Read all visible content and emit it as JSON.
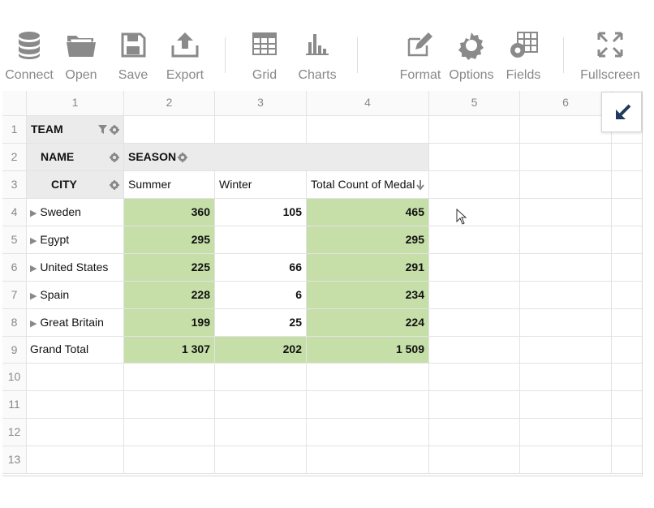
{
  "toolbar": {
    "connect": "Connect",
    "open": "Open",
    "save": "Save",
    "export": "Export",
    "grid": "Grid",
    "charts": "Charts",
    "format": "Format",
    "options": "Options",
    "fields": "Fields",
    "fullscreen": "Fullscreen"
  },
  "columns": [
    "1",
    "2",
    "3",
    "4",
    "5",
    "6"
  ],
  "rows": [
    "1",
    "2",
    "3",
    "4",
    "5",
    "6",
    "7",
    "8",
    "9",
    "10",
    "11",
    "12",
    "13"
  ],
  "pivot": {
    "team_label": "TEAM",
    "name_label": "NAME",
    "season_label": "SEASON",
    "city_label": "CITY",
    "col_headers": [
      "Summer",
      "Winter",
      "Total Count of Medal"
    ],
    "data_rows": [
      {
        "name": "Sweden",
        "summer": "360",
        "winter": "105",
        "total": "465"
      },
      {
        "name": "Egypt",
        "summer": "295",
        "winter": "",
        "total": "295"
      },
      {
        "name": "United States",
        "summer": "225",
        "winter": "66",
        "total": "291"
      },
      {
        "name": "Spain",
        "summer": "228",
        "winter": "6",
        "total": "234"
      },
      {
        "name": "Great Britain",
        "summer": "199",
        "winter": "25",
        "total": "224"
      }
    ],
    "grand_total": {
      "label": "Grand Total",
      "summer": "1 307",
      "winter": "202",
      "total": "1 509"
    }
  },
  "colors": {
    "accent_green": "#c6dfa9",
    "header_gray": "#ebebeb",
    "icon_gray": "#888888",
    "expand_icon": "#1f3a5c"
  }
}
